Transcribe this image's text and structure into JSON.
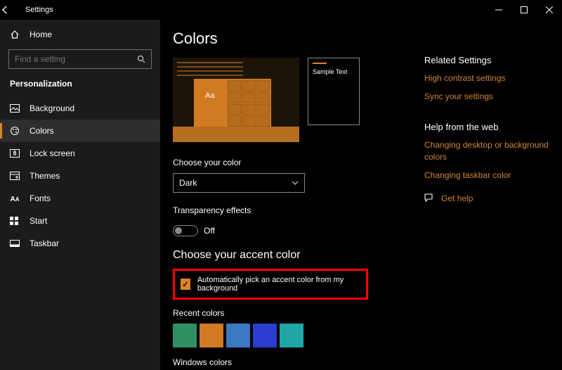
{
  "titlebar": {
    "title": "Settings"
  },
  "sidebar": {
    "home": "Home",
    "search_placeholder": "Find a setting",
    "category": "Personalization",
    "items": [
      {
        "label": "Background"
      },
      {
        "label": "Colors"
      },
      {
        "label": "Lock screen"
      },
      {
        "label": "Themes"
      },
      {
        "label": "Fonts"
      },
      {
        "label": "Start"
      },
      {
        "label": "Taskbar"
      }
    ]
  },
  "page": {
    "title": "Colors",
    "preview_sample": "Sample Text",
    "preview_aa": "Aa",
    "choose_color_label": "Choose your color",
    "choose_color_value": "Dark",
    "transparency_label": "Transparency effects",
    "transparency_state": "Off",
    "accent_heading": "Choose your accent color",
    "auto_pick_label": "Automatically pick an accent color from my background",
    "recent_colors_label": "Recent colors",
    "recent_colors": [
      "#2f8f63",
      "#d07a22",
      "#3b78c2",
      "#2b3cd0",
      "#1fa7a7"
    ],
    "windows_colors_label": "Windows colors"
  },
  "right": {
    "related_heading": "Related Settings",
    "links1": [
      "High contrast settings",
      "Sync your settings"
    ],
    "help_heading": "Help from the web",
    "links2": [
      "Changing desktop or background colors",
      "Changing taskbar color"
    ],
    "get_help": "Get help"
  }
}
